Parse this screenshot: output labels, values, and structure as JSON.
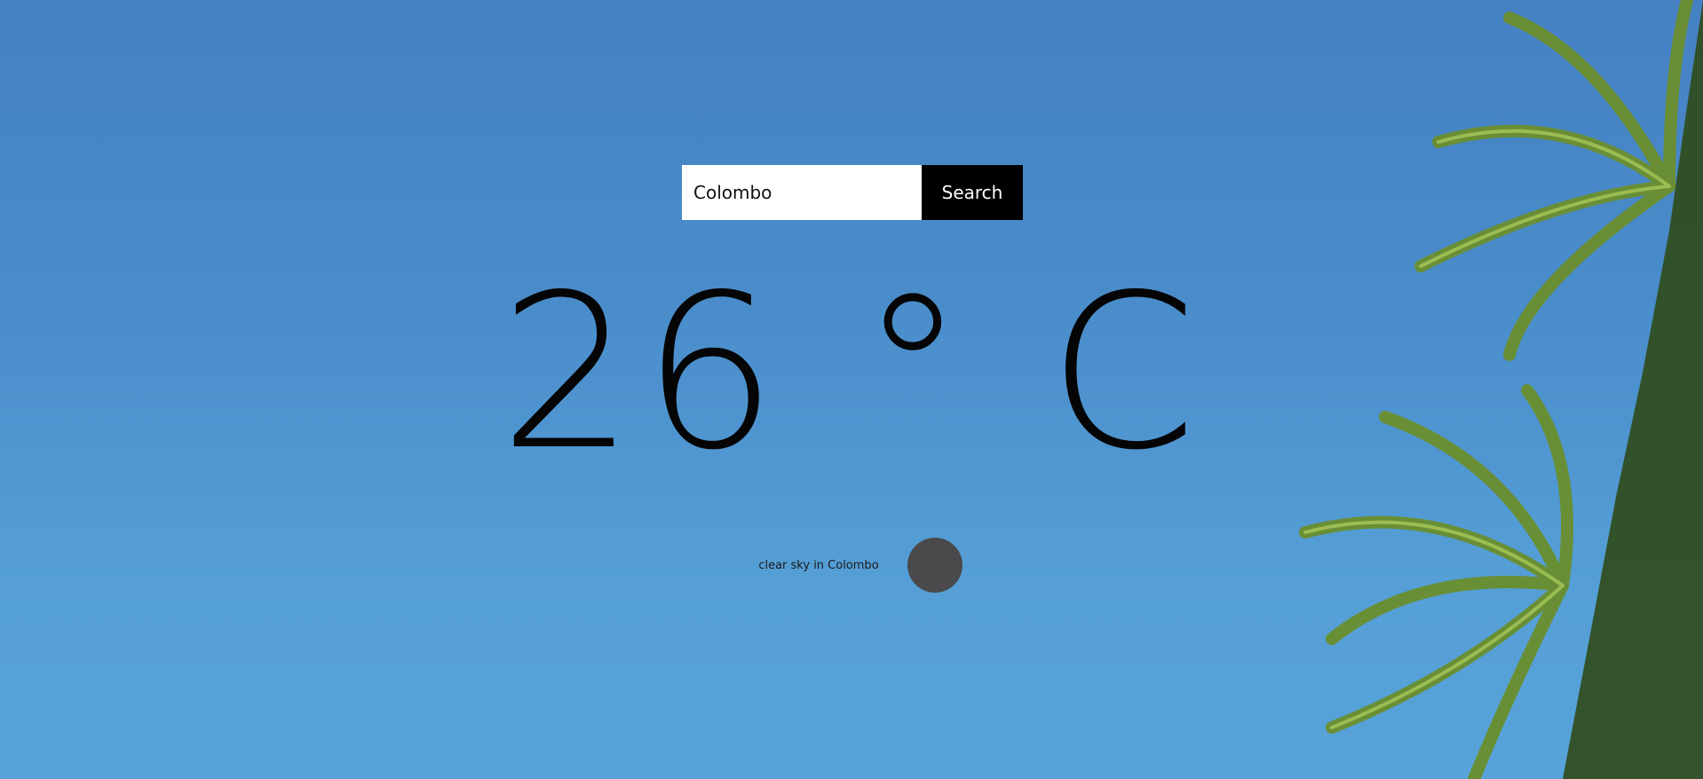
{
  "search": {
    "value": "Colombo",
    "button_label": "Search"
  },
  "weather": {
    "temperature": "26 ° C",
    "description": "clear sky in Colombo",
    "icon": "weather-condition-icon"
  },
  "background": {
    "sky_color": "#4a8dcb",
    "image": "palm-trees-photo"
  }
}
